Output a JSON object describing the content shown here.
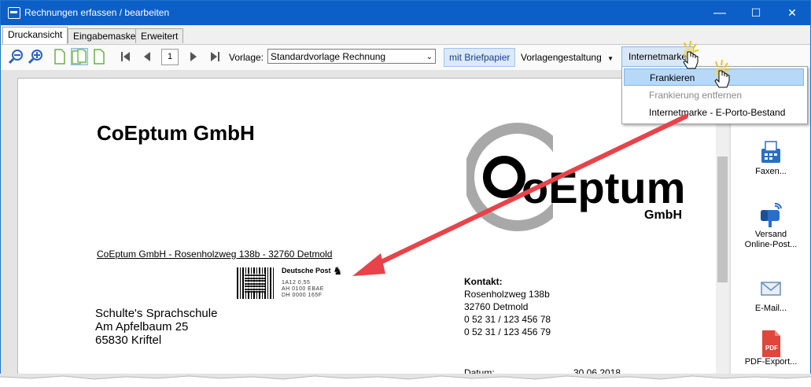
{
  "window": {
    "title": "Rechnungen erfassen / bearbeiten",
    "minimize": "—",
    "maximize": "☐",
    "close": "✕"
  },
  "tabs": [
    "Druckansicht",
    "Eingabemaske",
    "Erweitert"
  ],
  "toolbar": {
    "page_number": "1",
    "vorlage_label": "Vorlage:",
    "vorlage_value": "Standardvorlage Rechnung",
    "briefpapier_label": "mit Briefpapier",
    "vorlagengestaltung_label": "Vorlagengestaltung",
    "internetmarke_label": "Internetmarke"
  },
  "menu": {
    "items": [
      {
        "label": "Frankieren",
        "state": "selected"
      },
      {
        "label": "Frankierung entfernen",
        "state": "disabled"
      },
      {
        "label": "Internetmarke - E-Porto-Bestand",
        "state": "normal"
      }
    ]
  },
  "document": {
    "company": "CoEptum GmbH",
    "logo_text": "oEptum",
    "logo_subtext": "GmbH",
    "sender_line": "CoEptum GmbH - Rosenholzweg 138b - 32760 Detmold",
    "stamp": {
      "brand": "Deutsche Post",
      "row1": "1A12        0,55",
      "row2": "AH  0100  EBAE",
      "row3": "DH  0000  165F"
    },
    "recipient": [
      "Schulte's Sprachschule",
      "Am Apfelbaum 25",
      "65830 Kriftel"
    ],
    "contact_label": "Kontakt:",
    "contact_lines": [
      "Rosenholzweg 138b",
      "32760 Detmold",
      "0 52 31 / 123 456 78",
      "0 52 31 / 123 456 79"
    ],
    "datum_label": "Datum:",
    "datum_value": "30.06.2018"
  },
  "side_panel": {
    "items": [
      {
        "label": "Faxen...",
        "icon": "fax-icon"
      },
      {
        "label": "Versand Online-Post...",
        "icon": "mailbox-icon"
      },
      {
        "label": "E-Mail...",
        "icon": "envelope-icon"
      },
      {
        "label": "PDF-Export...",
        "icon": "pdf-icon"
      }
    ]
  },
  "colors": {
    "titlebar": "#0b5fc6",
    "arrow": "#e8434a",
    "menu_selected": "#b8d8f7"
  }
}
